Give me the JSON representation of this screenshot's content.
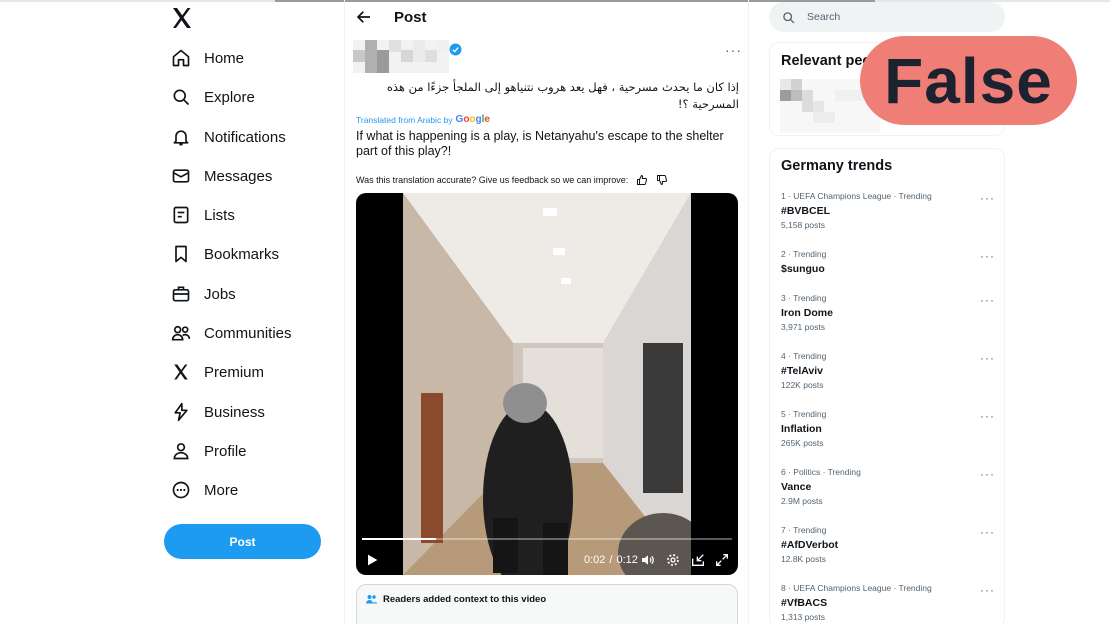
{
  "nav": {
    "items": [
      {
        "label": "Home",
        "icon": "home-icon"
      },
      {
        "label": "Explore",
        "icon": "search-icon"
      },
      {
        "label": "Notifications",
        "icon": "bell-icon"
      },
      {
        "label": "Messages",
        "icon": "mail-icon"
      },
      {
        "label": "Lists",
        "icon": "list-icon"
      },
      {
        "label": "Bookmarks",
        "icon": "bookmark-icon"
      },
      {
        "label": "Jobs",
        "icon": "briefcase-icon"
      },
      {
        "label": "Communities",
        "icon": "people-icon"
      },
      {
        "label": "Premium",
        "icon": "x-logo-icon"
      },
      {
        "label": "Business",
        "icon": "bolt-icon"
      },
      {
        "label": "Profile",
        "icon": "person-icon"
      },
      {
        "label": "More",
        "icon": "more-circle-icon"
      }
    ],
    "post_label": "Post"
  },
  "post": {
    "header_title": "Post",
    "arabic_text": "إذا كان ما يحدث مسرحية ، فهل يعد هروب نتنياهو إلى الملجأ جزءًا من هذه المسرحية ؟!",
    "translated_from": "Translated from Arabic by",
    "google": [
      "G",
      "o",
      "o",
      "g",
      "l",
      "e"
    ],
    "translation": "If what is happening is a play, is Netanyahu's escape to the shelter part of this play?!",
    "feedback_prompt": "Was this translation accurate? Give us feedback so we can improve:",
    "video": {
      "current_time": "0:02",
      "separator": "/",
      "duration": "0:12",
      "progress": 0.2
    },
    "context_label": "Readers added context to this video"
  },
  "right": {
    "search_placeholder": "Search",
    "relevant_title": "Relevant people",
    "verdict_badge": "False",
    "trends_title": "Germany trends",
    "trends": [
      {
        "meta": "1 · UEFA Champions League · Trending",
        "name": "#BVBCEL",
        "count": "5,158 posts"
      },
      {
        "meta": "2 · Trending",
        "name": "$sunguo",
        "count": ""
      },
      {
        "meta": "3 · Trending",
        "name": "Iron Dome",
        "count": "3,971 posts"
      },
      {
        "meta": "4 · Trending",
        "name": "#TelAviv",
        "count": "122K posts"
      },
      {
        "meta": "5 · Trending",
        "name": "Inflation",
        "count": "265K posts"
      },
      {
        "meta": "6 · Politics · Trending",
        "name": "Vance",
        "count": "2.9M posts"
      },
      {
        "meta": "7 · Trending",
        "name": "#AfDVerbot",
        "count": "12.8K posts"
      },
      {
        "meta": "8 · UEFA Champions League · Trending",
        "name": "#VfBACS",
        "count": "1,313 posts"
      }
    ]
  },
  "colors": {
    "accent": "#1d9bf0",
    "verdict_bg": "#ef7f76",
    "text_primary": "#0f1419",
    "text_secondary": "#536471"
  }
}
